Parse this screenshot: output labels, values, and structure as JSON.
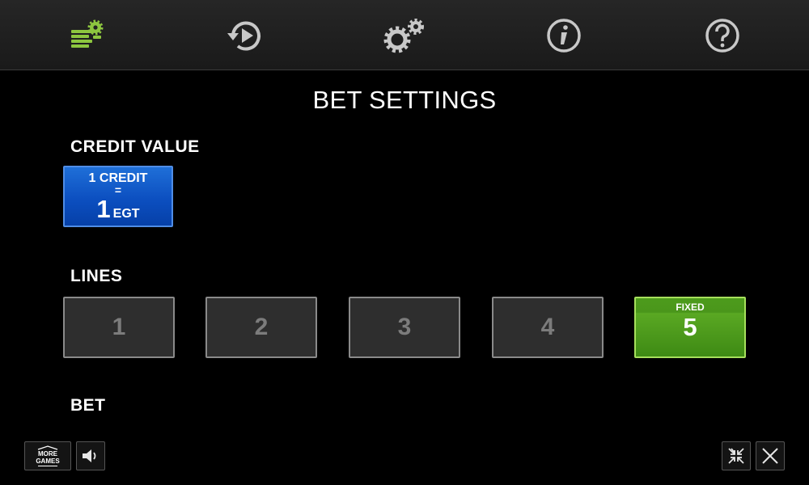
{
  "nav": {
    "tabs": [
      {
        "id": "bet-settings",
        "icon": "coins-gear-icon",
        "active": true,
        "color": "#8dc63f"
      },
      {
        "id": "autoplay",
        "icon": "replay-play-icon"
      },
      {
        "id": "settings",
        "icon": "gears-icon"
      },
      {
        "id": "info",
        "icon": "info-icon"
      },
      {
        "id": "help",
        "icon": "help-icon"
      }
    ]
  },
  "title": "BET SETTINGS",
  "credit": {
    "label": "CREDIT VALUE",
    "line1": "1 CREDIT",
    "equals": "=",
    "value": "1",
    "currency": "EGT",
    "color": "#0c4fc0"
  },
  "lines": {
    "label": "LINES",
    "options": [
      "1",
      "2",
      "3",
      "4"
    ],
    "selected_label": "FIXED",
    "selected_value": "5",
    "selected_color": "#4a961b"
  },
  "bet": {
    "label": "BET"
  },
  "footer": {
    "more_games_line1": "MORE",
    "more_games_line2": "GAMES",
    "sound_icon": "speaker-icon",
    "exit_fullscreen_icon": "exit-fullscreen-icon",
    "close_icon": "close-icon"
  }
}
